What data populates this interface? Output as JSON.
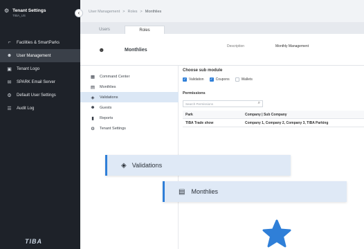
{
  "tenant": {
    "title": "Tenant Settings",
    "subtitle": "TIBA_US",
    "icon": "gear-icon"
  },
  "sidebar": {
    "collapse_icon": "chevron-left-icon",
    "items": [
      {
        "label": "Facilities & SmartParks",
        "icon": "parking-icon",
        "active": false
      },
      {
        "label": "User Management",
        "icon": "users-icon",
        "active": true
      },
      {
        "label": "Tenant Logo",
        "icon": "image-icon",
        "active": false
      },
      {
        "label": "SPARK Email Server",
        "icon": "mail-icon",
        "active": false
      },
      {
        "label": "Default User Settings",
        "icon": "user-settings-icon",
        "active": false
      },
      {
        "label": "Audit Log",
        "icon": "audit-icon",
        "active": false
      }
    ],
    "logo": "TIBA"
  },
  "breadcrumb": {
    "items": [
      "User Management",
      "Roles",
      "Monthlies"
    ],
    "separator": ">"
  },
  "tabs": {
    "users": "Users",
    "roles": "Roles",
    "active": "Roles"
  },
  "role": {
    "name": "Monthlies",
    "description_label": "Description",
    "description_value": "Monthly Management"
  },
  "modules": {
    "items": [
      {
        "label": "Command Center",
        "icon": "command-center-icon"
      },
      {
        "label": "Monthlies",
        "icon": "id-card-icon"
      },
      {
        "label": "Validations",
        "icon": "ticket-icon",
        "active": true
      },
      {
        "label": "Guests",
        "icon": "guests-icon"
      },
      {
        "label": "Reports",
        "icon": "report-icon"
      },
      {
        "label": "Tenant Settings",
        "icon": "settings-icon"
      }
    ]
  },
  "submodule": {
    "title": "Choose sub module",
    "options": [
      {
        "label": "Validation",
        "checked": true
      },
      {
        "label": "Coupons",
        "checked": true
      },
      {
        "label": "Wallets",
        "checked": false
      }
    ]
  },
  "permissions": {
    "title": "Permissions",
    "search_placeholder": "Search Permissions",
    "columns": [
      "Park",
      "Company | Sub Company"
    ],
    "rows": [
      [
        "TIBA Trade show",
        "Company 1, Company 2, Company 3, TIBA Parking"
      ]
    ]
  },
  "floating": {
    "validations": "Validations",
    "monthlies": "Monthlies"
  },
  "colors": {
    "sidebar_bg": "#1e2229",
    "accent": "#2f7fd8",
    "highlight": "#dbe7f5",
    "star": "#2f7fd8"
  }
}
